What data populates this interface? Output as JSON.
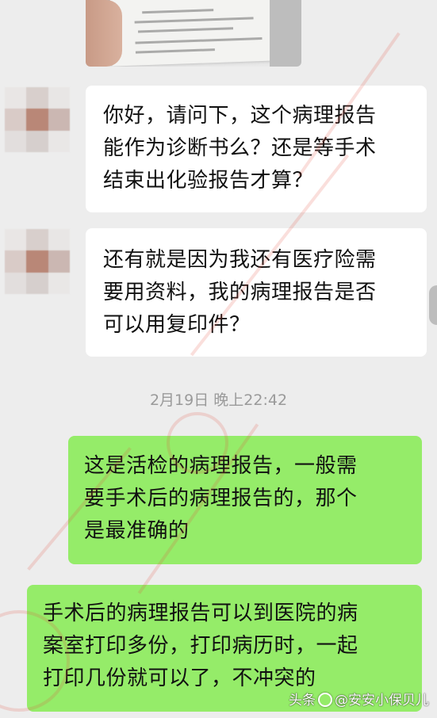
{
  "messages": [
    {
      "side": "left",
      "lines": [
        "你好，请问下，这个病理报告",
        "能作为诊断书么？还是等手术",
        "结束出化验报告才算？"
      ]
    },
    {
      "side": "left",
      "lines": [
        "还有就是因为我还有医疗险需",
        "要用资料，我的病理报告是否",
        "可以用复印件？"
      ]
    }
  ],
  "timestamp": "2月19日 晚上22:42",
  "replies": [
    {
      "side": "right",
      "lines": [
        "这是活检的病理报告，一般需",
        "要手术后的病理报告的，那个",
        "是最准确的"
      ]
    },
    {
      "side": "right",
      "lines": [
        "手术后的病理报告可以到医院的病",
        "案室打印多份，打印病历时，一起",
        "打印几份就可以了，不冲突的"
      ]
    }
  ],
  "credit": {
    "prefix": "头条",
    "handle": "@安安小保贝儿"
  },
  "colors": {
    "background": "#ededed",
    "received_bubble": "#ffffff",
    "sent_bubble": "#95ec69",
    "watermark": "#e6503c"
  }
}
